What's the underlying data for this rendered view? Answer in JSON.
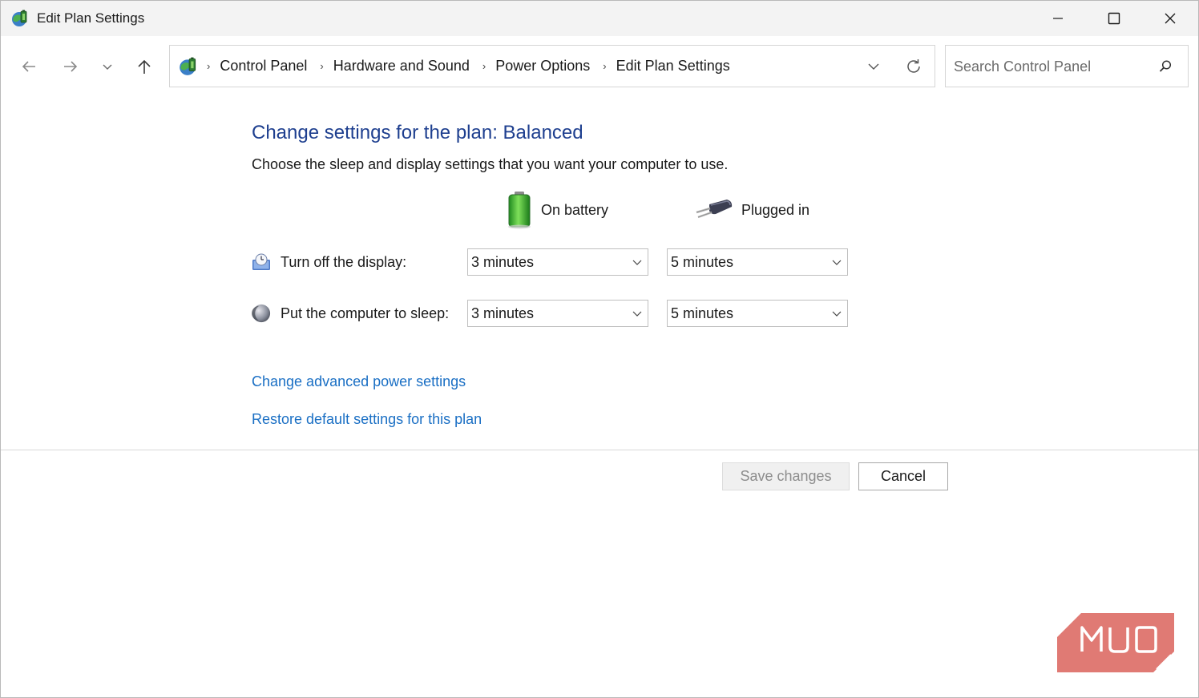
{
  "window": {
    "title": "Edit Plan Settings"
  },
  "breadcrumbs": [
    "Control Panel",
    "Hardware and Sound",
    "Power Options",
    "Edit Plan Settings"
  ],
  "search": {
    "placeholder": "Search Control Panel"
  },
  "content": {
    "heading": "Change settings for the plan: Balanced",
    "description": "Choose the sleep and display settings that you want your computer to use.",
    "columns": {
      "on_battery": "On battery",
      "plugged_in": "Plugged in"
    },
    "rows": {
      "display": {
        "label": "Turn off the display:",
        "on_battery": "3 minutes",
        "plugged_in": "5 minutes"
      },
      "sleep": {
        "label": "Put the computer to sleep:",
        "on_battery": "3 minutes",
        "plugged_in": "5 minutes"
      }
    },
    "links": {
      "advanced": "Change advanced power settings",
      "restore": "Restore default settings for this plan"
    }
  },
  "buttons": {
    "save": "Save changes",
    "cancel": "Cancel"
  },
  "watermark": {
    "text": "MUO"
  },
  "colors": {
    "heading": "#1e3f8f",
    "link": "#1a6fc4",
    "watermark": "#e07a74"
  }
}
